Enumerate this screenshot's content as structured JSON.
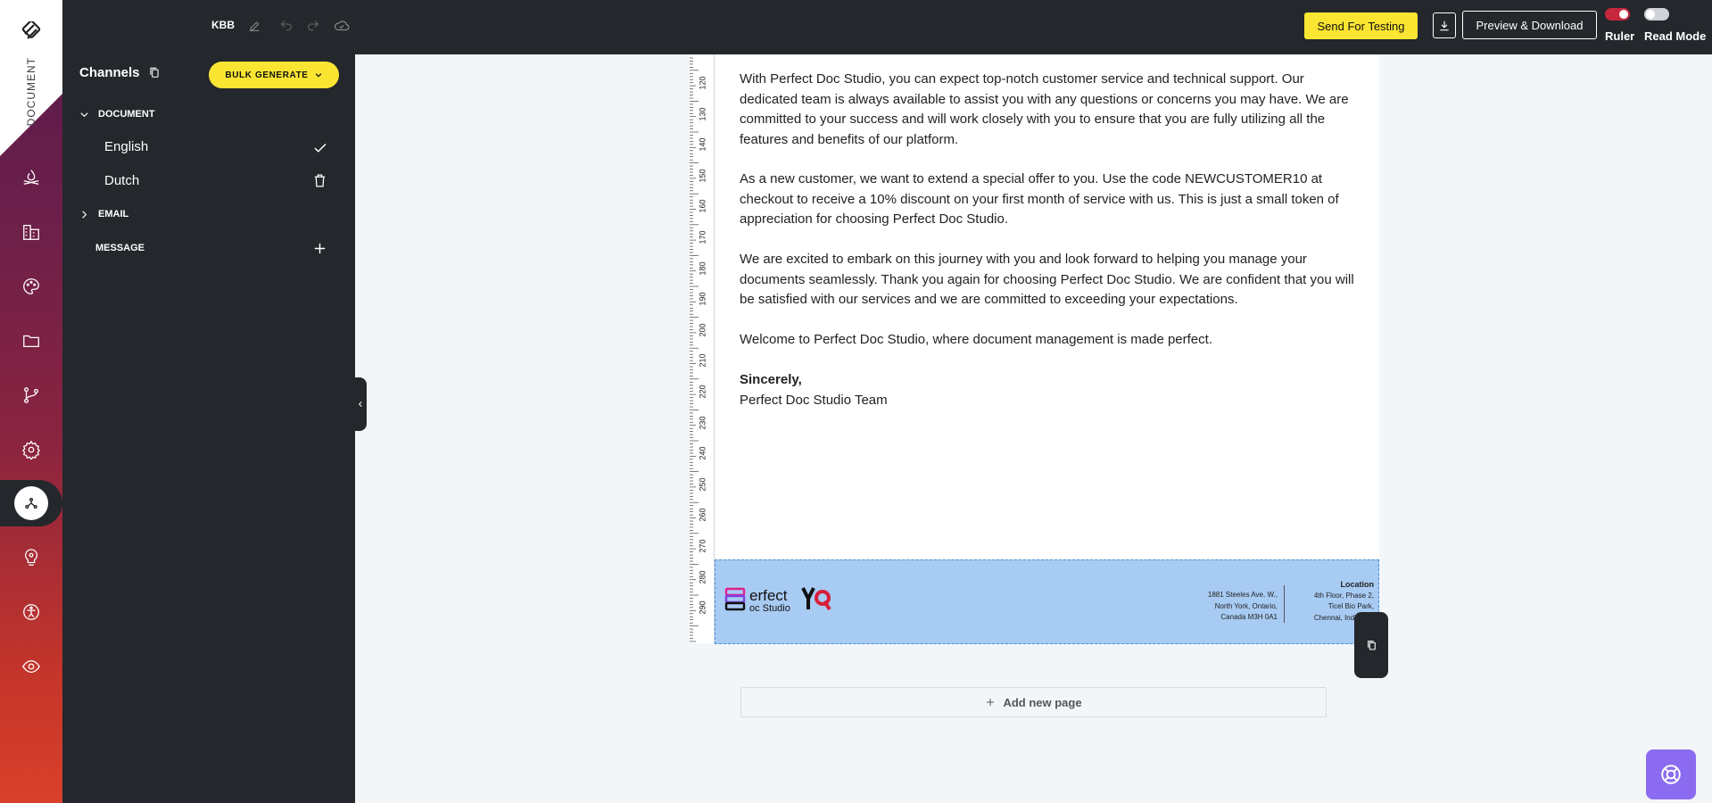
{
  "rail": {
    "doc_label": "DOCUMENT",
    "icons": [
      "campfire-icon",
      "buildings-icon",
      "palette-icon",
      "folder-icon",
      "branch-icon",
      "settings-icon",
      "channels-icon",
      "bulb-icon",
      "accessibility-icon",
      "eye-icon"
    ]
  },
  "topbar": {
    "project": "KBB",
    "send_label": "Send For Testing",
    "preview_label": "Preview & Download",
    "ruler_label": "Ruler",
    "read_mode_label": "Read Mode",
    "ruler_on": true,
    "read_mode_on": false,
    "accent_red": "#c5283d",
    "accent_yellow": "#fae532"
  },
  "channels": {
    "title": "Channels",
    "bulk_label": "BULK GENERATE",
    "document_label": "DOCUMENT",
    "document_items": [
      {
        "label": "English",
        "action": "check-icon"
      },
      {
        "label": "Dutch",
        "action": "trash-icon"
      }
    ],
    "email_label": "EMAIL",
    "message_label": "MESSAGE"
  },
  "document": {
    "ruler_marks": [
      "120",
      "130",
      "140",
      "150",
      "160",
      "170",
      "180",
      "190",
      "200",
      "210",
      "220",
      "230",
      "240",
      "250",
      "260",
      "270",
      "280",
      "290"
    ],
    "paragraphs": [
      "With Perfect Doc Studio, you can expect top-notch customer service and technical support. Our dedicated team is always available to assist you with any questions or concerns you may have. We are committed to your success and will work closely with you to ensure that you are fully utilizing all the features and benefits of our platform.",
      "As a new customer, we want to extend a special offer to you. Use the code NEWCUSTOMER10 at checkout to receive a 10% discount on your first month of service with us. This is just a small token of appreciation for choosing Perfect Doc Studio.",
      "We are excited to embark on this journey with you and look forward to helping you manage your documents seamlessly. Thank you again for choosing Perfect Doc Studio. We are confident that you will be satisfied with our services and we are committed to exceeding your expectations.",
      "Welcome to Perfect Doc Studio, where document management is made perfect."
    ],
    "closing": "Sincerely,",
    "signature": "Perfect Doc Studio Team",
    "footer": {
      "logo_main": "erfect",
      "logo_sub": "oc Studio",
      "address1": [
        "1881 Steeles Ave. W.,",
        "North York, Ontario,",
        "Canada M3H 0A1"
      ],
      "location_title": "Location",
      "address2": [
        "4th Floor, Phase 2,",
        "Ticel Bio Park,",
        "Chennai, India 600"
      ]
    },
    "add_page_label": "Add new page"
  }
}
